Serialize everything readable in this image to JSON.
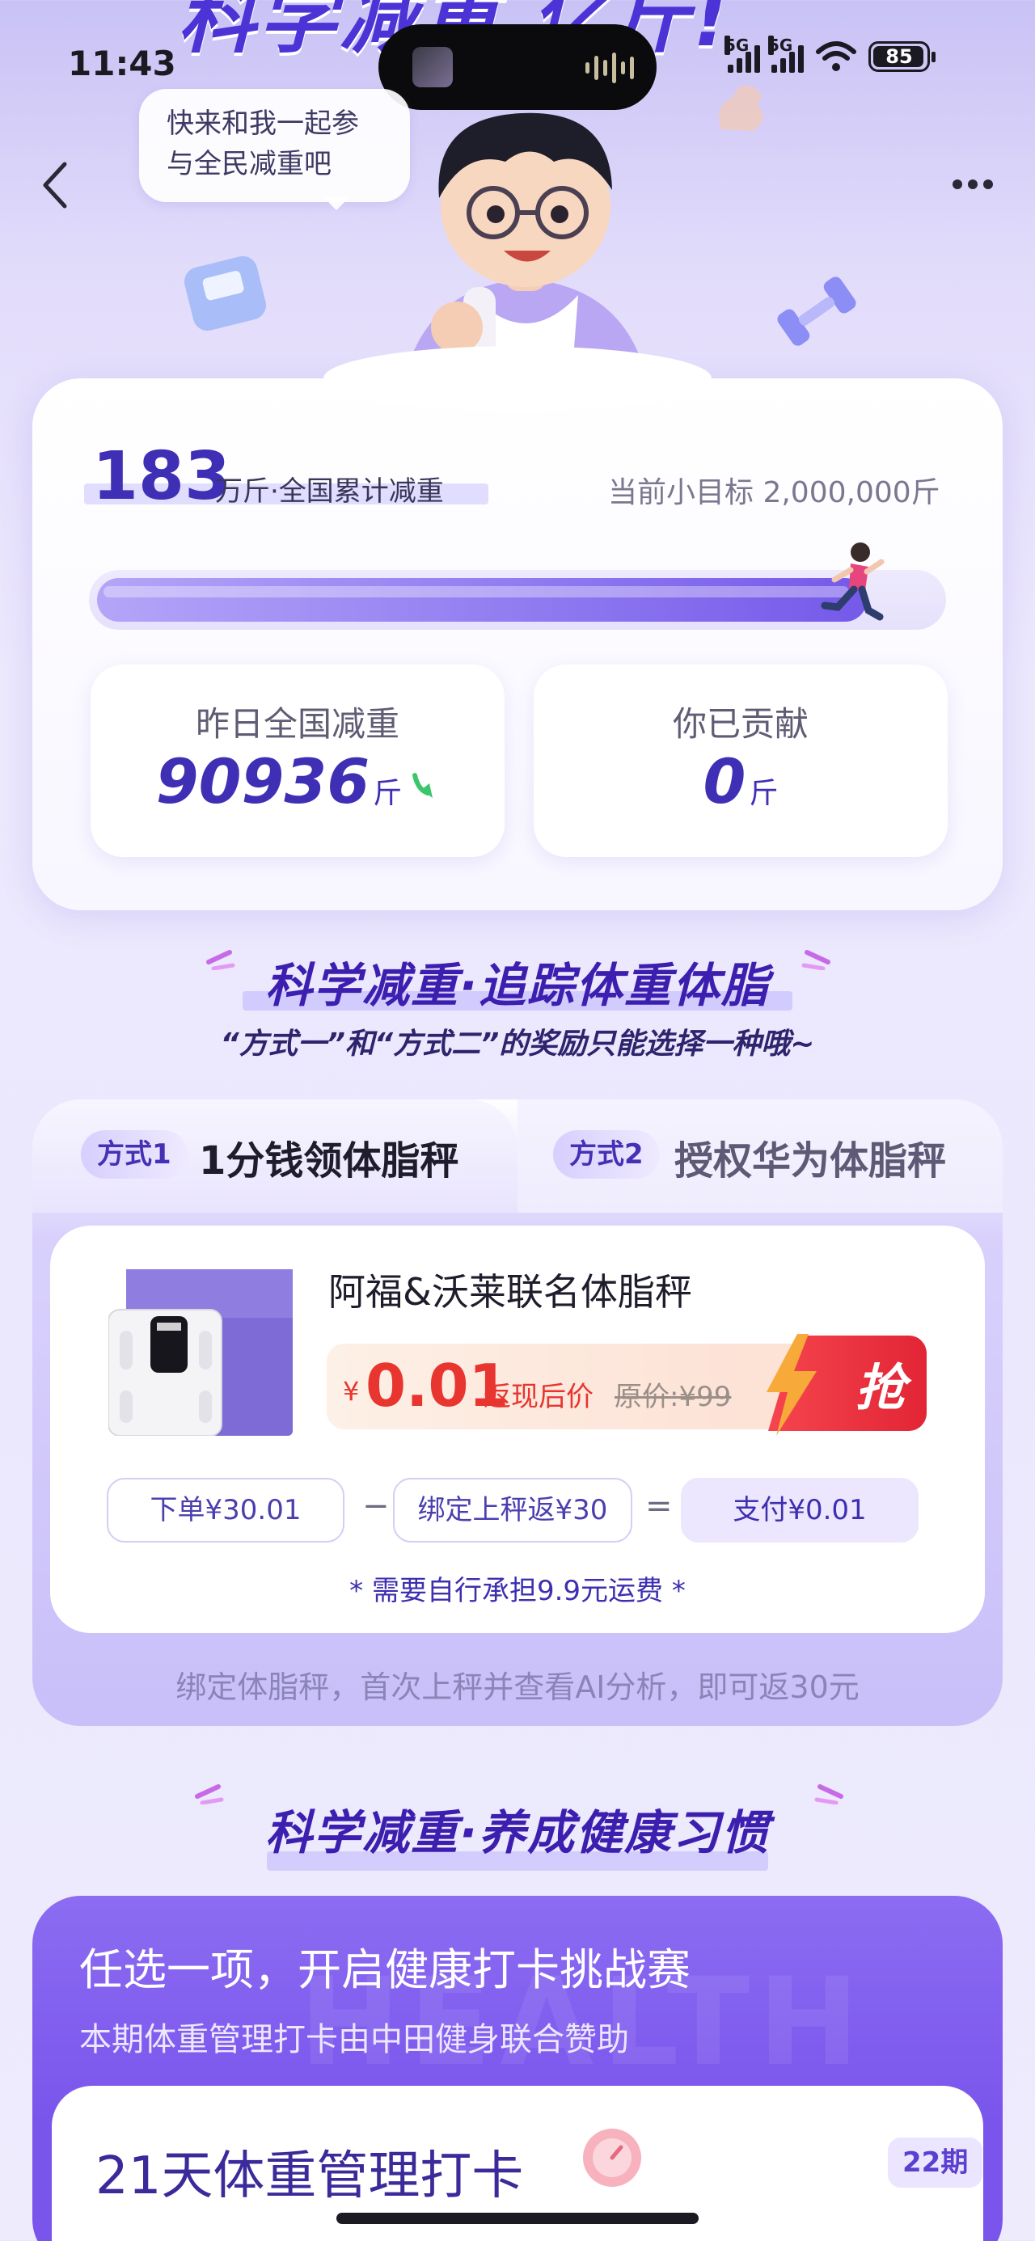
{
  "hero": {
    "title_partial": "科学减重 亿斤!",
    "speech": "快来和我一起参与全民减重吧"
  },
  "status_bar": {
    "time": "11:43",
    "signal1_label": "5G",
    "signal2_label": "5G",
    "battery": "85"
  },
  "stats": {
    "total_value": "183",
    "total_label": "万斤·全国累计减重",
    "goal_label": "当前小目标 2,000,000斤",
    "progress_fraction": 0.915,
    "yesterday_label": "昨日全国减重",
    "yesterday_value": "90936",
    "yesterday_unit": "斤",
    "contrib_label": "你已贡献",
    "contrib_value": "0",
    "contrib_unit": "斤"
  },
  "section1": {
    "title": "科学减重·追踪体重体脂",
    "subtitle": "“方式一”和“方式二”的奖励只能选择一种哦~"
  },
  "tabs": [
    {
      "pill": "方式1",
      "label": "1分钱领体脂秤"
    },
    {
      "pill": "方式2",
      "label": "授权华为体脂秤"
    }
  ],
  "product": {
    "name": "阿福&沃莱联名体脂秤",
    "price_symbol": "¥",
    "price": "0.01",
    "price_tag": "返现后价",
    "original_price": "原价:¥99",
    "grab_label": "抢",
    "formula": {
      "order": "下单¥30.01",
      "minus": "−",
      "rebate": "绑定上秤返¥30",
      "equals": "=",
      "pay": "支付¥0.01"
    },
    "shipping_note": "* 需要自行承担9.9元运费 *"
  },
  "rebate_note": "绑定体脂秤，首次上秤并查看AI分析，即可返30元",
  "section2": {
    "title": "科学减重·养成健康习惯"
  },
  "challenge": {
    "title": "任选一项，开启健康打卡挑战赛",
    "subtitle": "本期体重管理打卡由中田健身联合赞助",
    "watermark": "HEALTH",
    "item_title": "21天体重管理打卡",
    "item_badge": "22期"
  },
  "colors": {
    "brand_purple": "#3f2fb5",
    "accent_red": "#e8352f",
    "challenge_bg": "#7a55ec"
  }
}
